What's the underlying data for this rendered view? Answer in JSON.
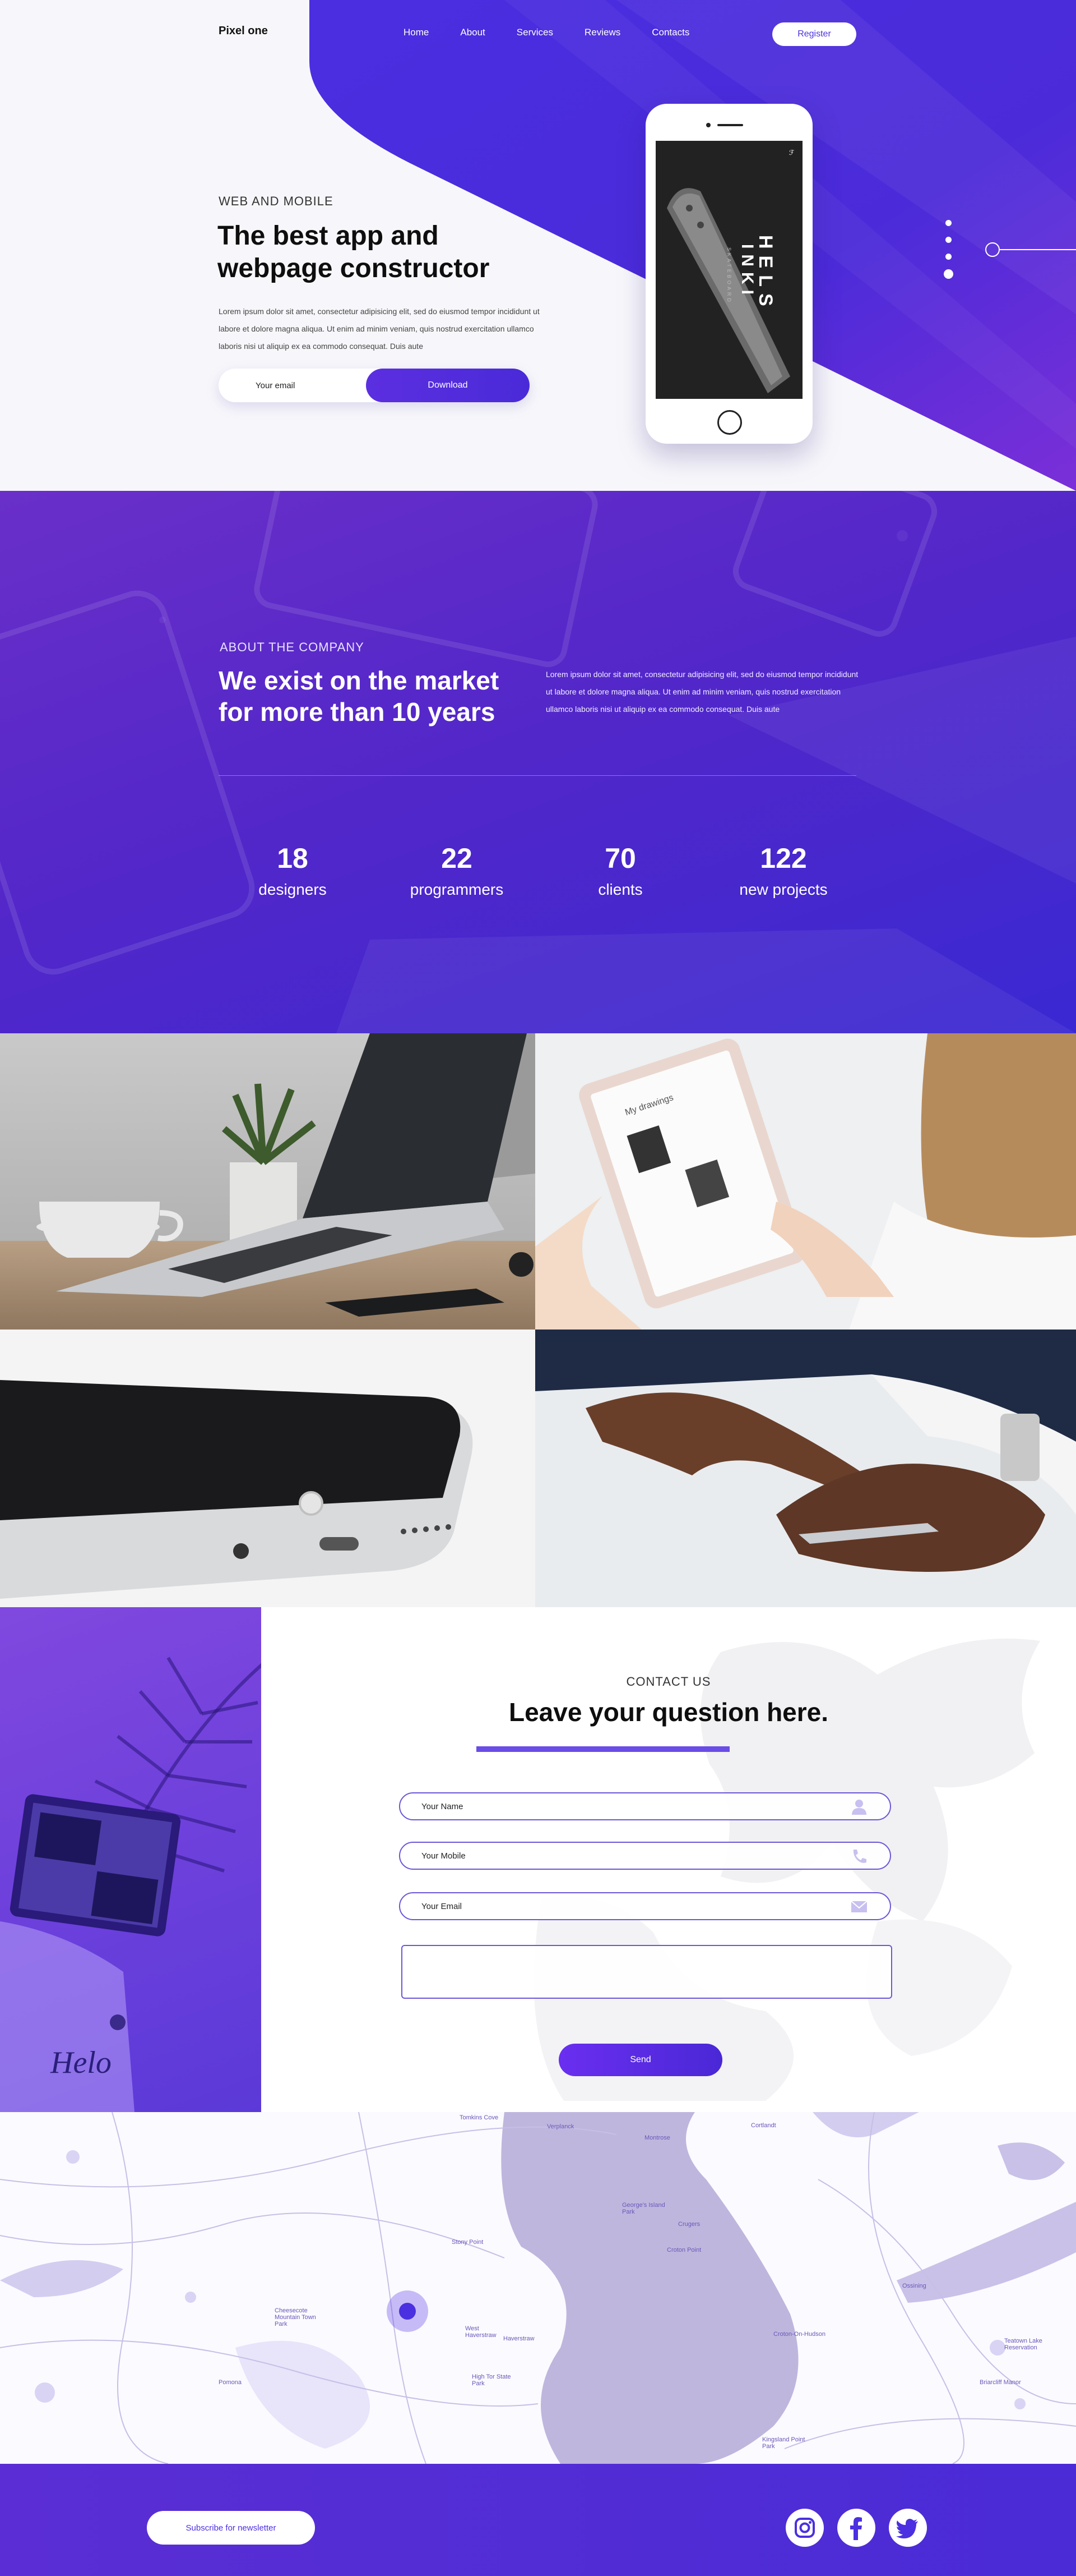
{
  "brand": {
    "name": "Pixel one"
  },
  "nav": {
    "items": [
      "Home",
      "About",
      "Services",
      "Reviews",
      "Contacts"
    ],
    "register_label": "Register"
  },
  "hero": {
    "kicker": "WEB AND MOBILE",
    "title": "The best app and webpage constructor",
    "text": "Lorem ipsum dolor sit amet, consectetur adipisicing elit, sed do eiusmod tempor incididunt ut labore et dolore magna aliqua. Ut enim ad minim veniam, quis nostrud exercitation ullamco laboris nisi ut aliquip ex ea commodo consequat. Duis aute",
    "email_placeholder": "Your email",
    "download_label": "Download",
    "phone_screen": {
      "word_top": "HELS",
      "word_bottom": "INKI",
      "small": "SKATEBOARD",
      "logo": "ℱ"
    }
  },
  "about": {
    "kicker": "ABOUT THE COMPANY",
    "title": "We exist on the market for more than 10 years",
    "text": "Lorem ipsum dolor sit amet, consectetur adipisicing elit, sed do eiusmod tempor incididunt ut labore et dolore magna aliqua. Ut enim ad minim veniam, quis nostrud exercitation ullamco laboris nisi ut aliquip ex ea commodo consequat. Duis aute",
    "stats": [
      {
        "number": "18",
        "label": "designers"
      },
      {
        "number": "22",
        "label": "programmers"
      },
      {
        "number": "70",
        "label": "clients"
      },
      {
        "number": "122",
        "label": "new projects"
      }
    ]
  },
  "gallery": {
    "tablet_caption": "My drawings"
  },
  "contact": {
    "kicker": "CONTACT US",
    "title": "Leave your question here.",
    "name_placeholder": "Your Name",
    "mobile_placeholder": "Your Mobile",
    "email_placeholder": "Your Email",
    "send_label": "Send",
    "side_text": "Helo"
  },
  "map": {
    "labels": [
      "Tomkins Cove",
      "Verplanck",
      "Montrose",
      "Cortlandt",
      "George's Island Park",
      "Crugers",
      "Croton Point",
      "Cheesecote Mountain Town Park",
      "Stony Point",
      "Haverstraw",
      "West Haverstraw",
      "High Tor State Park",
      "Pomona",
      "Croton-On-Hudson",
      "Briarcliff Manor",
      "Ossining",
      "Teatown Lake Reservation",
      "Kingsland Point Park"
    ]
  },
  "footer": {
    "newsletter_label": "Subscribe for newsletter",
    "social": [
      "instagram-icon",
      "facebook-icon",
      "twitter-icon"
    ]
  },
  "colors": {
    "accent": "#4a30e0",
    "accent_dark": "#3a28d2",
    "purple": "#6a2fc9"
  }
}
